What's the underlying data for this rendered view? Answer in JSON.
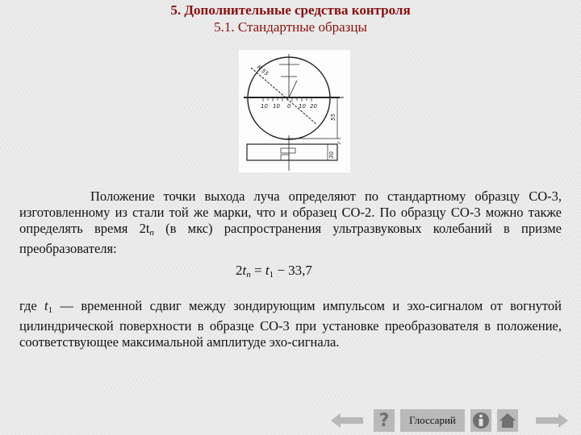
{
  "header": {
    "title": "5. Дополнительные средства контроля",
    "subtitle": "5.1. Стандартные образцы"
  },
  "figure": {
    "description": "Стандартный образец СО-3",
    "labels": {
      "radius": "R 55",
      "height": "55",
      "thickness": "30",
      "scale": [
        "10",
        "10",
        "0",
        "10",
        "20"
      ]
    }
  },
  "body": {
    "paragraph1": "Положение точки выхода луча определяют по стандартному образцу СО-3, изготовленному из стали той же марки, что и образец СО-2. По образцу СО-3 можно также определять время 2t",
    "paragraph1_sub": "п",
    "paragraph1_rest": " (в мкс) распространения ультразвуковых колебаний в призме преобразователя:",
    "formula": {
      "lhs_coef": "2",
      "lhs_var": "t",
      "lhs_sub": "п",
      "eq": " = ",
      "rhs_var": "t",
      "rhs_sub": "1",
      "rhs_rest": " − 33,7"
    },
    "paragraph2_pre": " где ",
    "paragraph2_var": "t",
    "paragraph2_sub": "1",
    "paragraph2": " — временной сдвиг между зондирующим импульсом и эхо-сигналом от вогнутой цилиндрической поверхности в образце СО-3 при установке преобразователя в положение, соответствующее максимальной амплитуде эхо-сигнала."
  },
  "nav": {
    "back_icon": "arrow-left-icon",
    "help_icon": "question-mark-icon",
    "glossary_label": "Глоссарий",
    "info_icon": "info-icon",
    "home_icon": "home-icon",
    "forward_icon": "arrow-right-icon"
  },
  "colors": {
    "title": "#8b0d0d",
    "nav_button": "#b9b9b9",
    "nav_icon": "#7d7d7d"
  }
}
